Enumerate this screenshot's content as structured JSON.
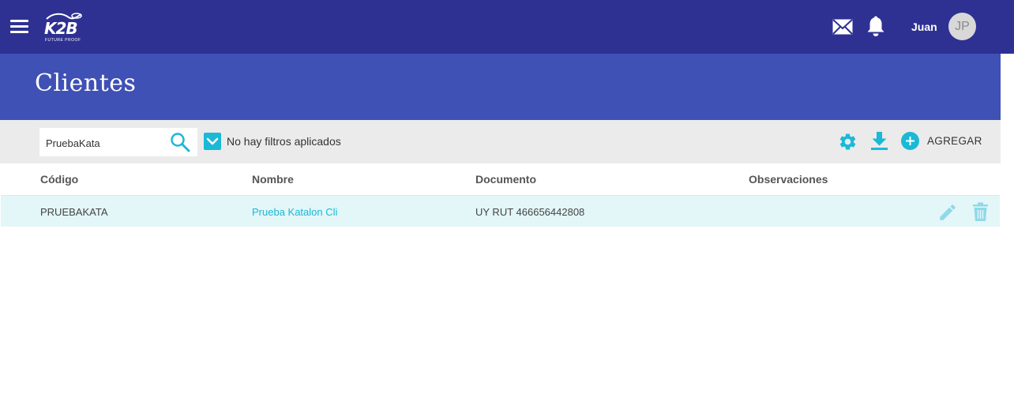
{
  "header": {
    "logo_text": "K2B",
    "logo_tagline": "FUTURE PROOF",
    "user_name": "Juan",
    "avatar_initials": "JP",
    "bar_color": "#2e3192"
  },
  "page": {
    "title": "Clientes",
    "band_color": "#3f51b5"
  },
  "toolbar": {
    "search_value": "PruebaKata",
    "filter_label": "No hay filtros aplicados",
    "filter_checked": true,
    "add_label": "AGREGAR",
    "accent_color": "#1ab9d6",
    "icons": [
      "search-icon",
      "gear-icon",
      "download-icon",
      "add-icon"
    ]
  },
  "table": {
    "columns": [
      "Código",
      "Nombre",
      "Documento",
      "Observaciones"
    ],
    "rows": [
      {
        "codigo": "PRUEBAKATA",
        "nombre": "Prueba Katalon Cli",
        "documento": "UY RUT 466656442808",
        "observaciones": ""
      }
    ],
    "row_actions": [
      "edit-icon",
      "delete-icon"
    ]
  }
}
